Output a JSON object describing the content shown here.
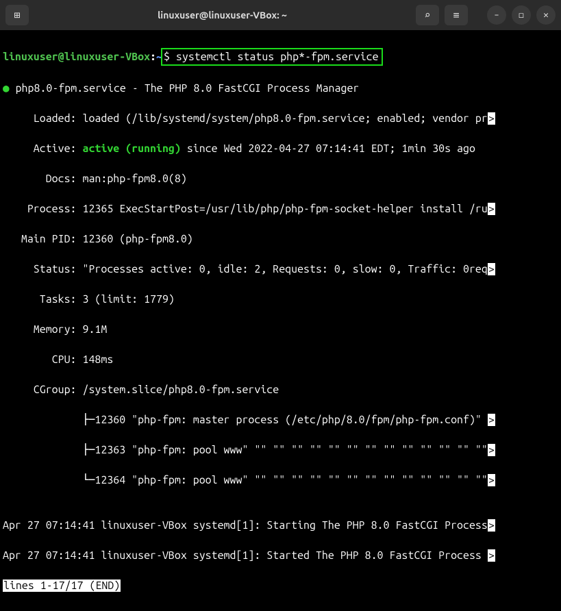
{
  "titlebar": {
    "title": "linuxuser@linuxuser-VBox: ~",
    "new_tab_icon": "⊞",
    "search_icon": "⌕",
    "menu_icon": "≡",
    "min_icon": "–",
    "max_icon": "◻",
    "close_icon": "✕"
  },
  "prompt": {
    "user": "linuxuser@linuxuser-VBox",
    "colon": ":",
    "path": "~",
    "dollar": "$ ",
    "command": "systemctl status php*-fpm.service"
  },
  "output": {
    "bullet": "●",
    "service_line": " php8.0-fpm.service - The PHP 8.0 FastCGI Process Manager",
    "loaded": "     Loaded: loaded (/lib/systemd/system/php8.0-fpm.service; enabled; vendor pr",
    "active_label": "     Active: ",
    "active_value": "active (running)",
    "active_since": " since Wed 2022-04-27 07:14:41 EDT; 1min 30s ago",
    "docs": "       Docs: man:php-fpm8.0(8)",
    "process": "    Process: 12365 ExecStartPost=/usr/lib/php/php-fpm-socket-helper install /ru",
    "mainpid": "   Main PID: 12360 (php-fpm8.0)",
    "status": "     Status: \"Processes active: 0, idle: 2, Requests: 0, slow: 0, Traffic: 0req",
    "tasks": "      Tasks: 3 (limit: 1779)",
    "memory": "     Memory: 9.1M",
    "cpu": "        CPU: 148ms",
    "cgroup": "     CGroup: /system.slice/php8.0-fpm.service",
    "tree1": "             ├─12360 \"php-fpm: master process (/etc/php/8.0/fpm/php-fpm.conf)\" ",
    "tree2": "             ├─12363 \"php-fpm: pool www\" \"\" \"\" \"\" \"\" \"\" \"\" \"\" \"\" \"\" \"\" \"\" \"\" \"\"",
    "tree3": "             └─12364 \"php-fpm: pool www\" \"\" \"\" \"\" \"\" \"\" \"\" \"\" \"\" \"\" \"\" \"\" \"\" \"\"",
    "blank": "",
    "log1": "Apr 27 07:14:41 linuxuser-VBox systemd[1]: Starting The PHP 8.0 FastCGI Process",
    "log2": "Apr 27 07:14:41 linuxuser-VBox systemd[1]: Started The PHP 8.0 FastCGI Process ",
    "pager": "lines 1-17/17 (END)",
    "trunc": ">"
  }
}
